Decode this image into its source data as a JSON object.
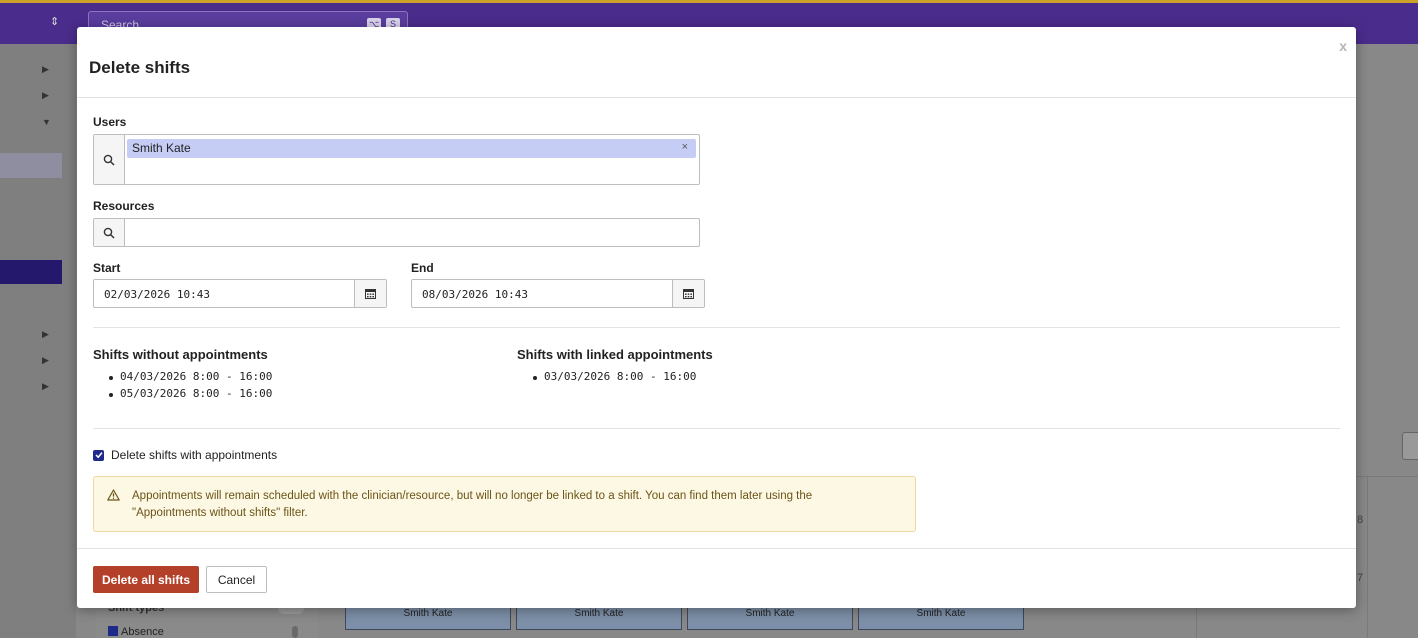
{
  "background": {
    "search_placeholder": "Search",
    "search_kbd": [
      "⌥",
      "S"
    ],
    "shift_types_label": "Shift types",
    "absence_label": "Absence",
    "shift_chips": [
      "Smith Kate",
      "Smith Kate",
      "Smith Kate",
      "Smith Kate"
    ],
    "day_numbers": [
      "8",
      "7"
    ]
  },
  "modal": {
    "title": "Delete shifts",
    "close_label": "x",
    "users": {
      "label": "Users",
      "selected": [
        "Smith Kate"
      ],
      "remove_label": "×"
    },
    "resources": {
      "label": "Resources",
      "value": ""
    },
    "start": {
      "label": "Start",
      "value": "02/03/2026 10:43"
    },
    "end": {
      "label": "End",
      "value": "08/03/2026 10:43"
    },
    "without_appointments": {
      "title": "Shifts without appointments",
      "items": [
        "04/03/2026 8:00 - 16:00",
        "05/03/2026 8:00 - 16:00"
      ]
    },
    "with_appointments": {
      "title": "Shifts with linked appointments",
      "items": [
        "03/03/2026 8:00 - 16:00"
      ]
    },
    "delete_with_appointments": {
      "label": "Delete shifts with appointments",
      "checked": true
    },
    "warning": {
      "line1": "Appointments will remain scheduled with the clinician/resource, but will no longer be linked to a shift. You can find them later using the",
      "line2": "\"Appointments without shifts\" filter."
    },
    "buttons": {
      "delete_all": "Delete all shifts",
      "cancel": "Cancel"
    }
  },
  "colors": {
    "topbar": "#4a2c8c",
    "danger": "#b5402a",
    "tag": "#c5cdf5",
    "warning_bg": "#fdf8e3",
    "checkbox": "#1e2a8a"
  }
}
